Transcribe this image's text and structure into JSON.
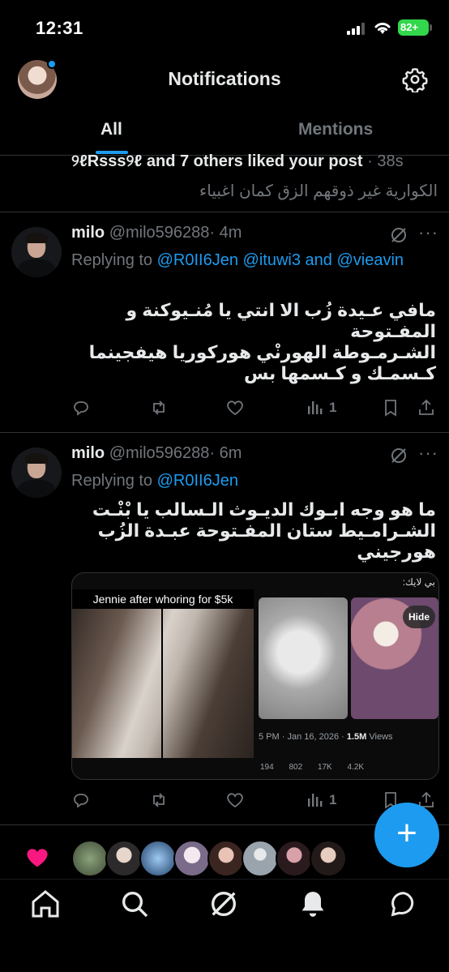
{
  "status_bar": {
    "time": "12:31",
    "battery": "82+"
  },
  "header": {
    "title": "Notifications"
  },
  "tabs": [
    {
      "label": "All",
      "active": true
    },
    {
      "label": "Mentions",
      "active": false
    }
  ],
  "like_notification": {
    "actor": "୨ℓRsss୨ℓ",
    "text": "and 7 others liked your post",
    "time": "· 38s",
    "preview": "الكوارية غير ذوقهم الزق كمان اغبياء"
  },
  "posts": [
    {
      "name": "milo",
      "handle": "@milo596288",
      "time": "· 4m",
      "replying_to": "Replying to",
      "mentions": "@R0II6Jen @ituwi3 and @vieavin",
      "text_lines": [
        "مافي عـيدة زُب الا انتي يا مُنـيوكنة و المفـتوحة",
        "الشـرمـوطة الهورنْي هوركوريا هيفجينما",
        "كـسمـك و كـسمها بس"
      ],
      "actions": {
        "views": "1"
      }
    },
    {
      "name": "milo",
      "handle": "@milo596288",
      "time": "· 6m",
      "replying_to": "Replying to",
      "mentions": "@R0II6Jen",
      "text_lines": [
        "ما هو وجه ابـوك الديـوث الـسالب يا بْنْـت",
        "الشـرامـيط ستان المفـتوحة عبـدة الزُب",
        "هورجيني"
      ],
      "media": {
        "caption": "Jennie after whoring for $5k",
        "quoted_header": "بي لايك:",
        "hide_label": "Hide",
        "quoted_meta_time": "5 PM · Jan 16, 2026 ·",
        "quoted_meta_views": "1.5M",
        "quoted_meta_views_label": "Views",
        "quoted_stats": [
          "194",
          "802",
          "17K",
          "4.2K"
        ]
      },
      "actions": {
        "views": "1"
      }
    }
  ],
  "fab_label": "+",
  "colors": {
    "accent": "#1d9bf0",
    "muted": "#71767b",
    "text": "#e7e9ea",
    "heart": "#f91880"
  }
}
